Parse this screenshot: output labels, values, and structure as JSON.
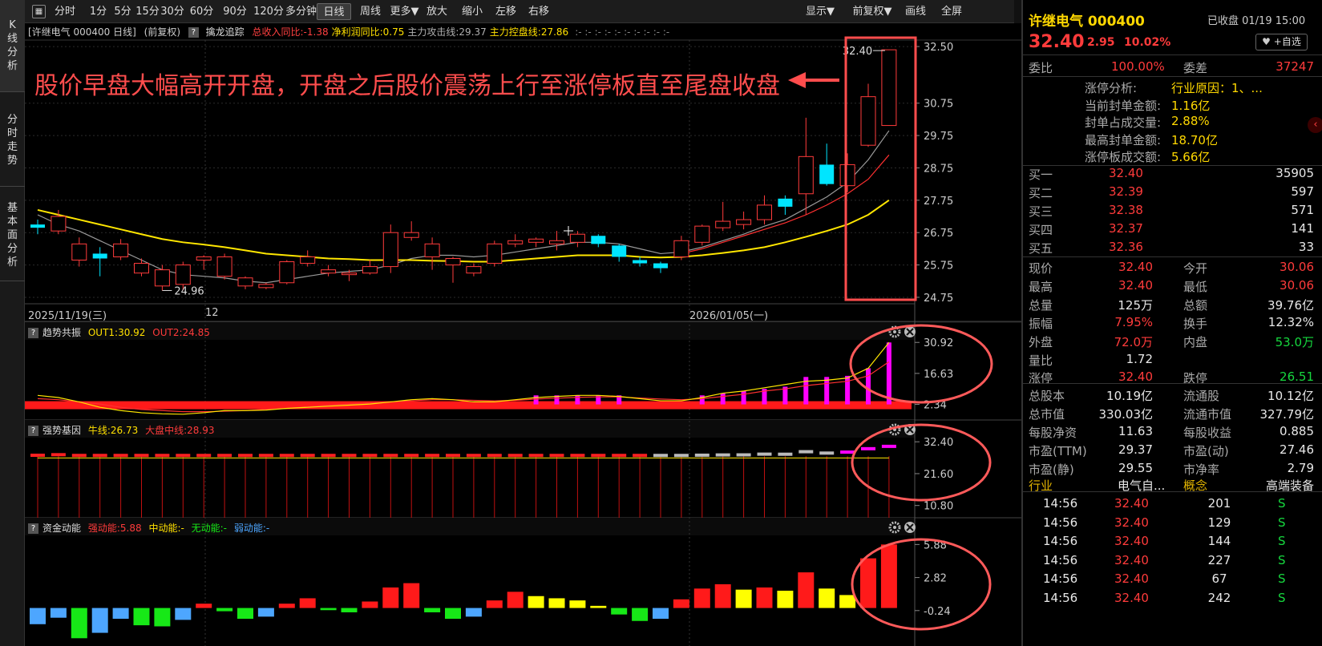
{
  "left_tabs": [
    {
      "label": "K线分析",
      "active": true
    },
    {
      "label": "分时走势",
      "active": false
    },
    {
      "label": "基本面分析",
      "active": false
    }
  ],
  "toolbar": {
    "left": [
      "分时",
      "1分",
      "5分",
      "15分",
      "30分",
      "60分",
      "90分",
      "120分",
      "多分钟",
      "日线",
      "周线",
      "更多▼",
      "放大",
      "缩小",
      "左移",
      "右移"
    ],
    "active": "日线",
    "right": [
      "显示▼",
      "前复权▼",
      "画线",
      "全屏"
    ]
  },
  "chart_info": {
    "stock_label": "[许继电气 000400 日线]",
    "fq": "(前复权)",
    "indicator": "擒龙追踪",
    "items": [
      {
        "text": "总收入同比:-1.38",
        "color": "#ff4040"
      },
      {
        "text": "净利润同比:0.75",
        "color": "#ffe000"
      },
      {
        "text": "主力攻击线:29.37",
        "color": "#b0b0b0"
      },
      {
        "text": "主力控盘线:27.86",
        "color": "#ffe000"
      }
    ]
  },
  "annotation": "股价早盘大幅高开开盘，开盘之后股价震荡上行至涨停板直至尾盘收盘",
  "dates": [
    "2025/11/19(三)",
    "12",
    "2026/01/05(一)"
  ],
  "chart_data": {
    "type": "candlestick",
    "y_ticks": [
      32.5,
      30.75,
      29.75,
      28.75,
      27.75,
      26.75,
      25.75,
      24.75
    ],
    "ylim": [
      24.6,
      32.7
    ],
    "candles": [
      {
        "o": 27.0,
        "c": 26.9,
        "h": 27.15,
        "l": 26.7
      },
      {
        "o": 26.8,
        "c": 27.25,
        "h": 27.45,
        "l": 26.7
      },
      {
        "o": 25.9,
        "c": 26.4,
        "h": 26.6,
        "l": 25.7
      },
      {
        "o": 26.1,
        "c": 25.95,
        "h": 26.3,
        "l": 25.4
      },
      {
        "o": 26.0,
        "c": 26.4,
        "h": 26.55,
        "l": 25.9
      },
      {
        "o": 25.5,
        "c": 25.8,
        "h": 25.95,
        "l": 25.4
      },
      {
        "o": 25.1,
        "c": 25.6,
        "h": 25.75,
        "l": 24.96
      },
      {
        "o": 25.15,
        "c": 25.75,
        "h": 25.85,
        "l": 24.96
      },
      {
        "o": 25.9,
        "c": 26.0,
        "h": 26.05,
        "l": 25.6
      },
      {
        "o": 25.4,
        "c": 26.0,
        "h": 26.1,
        "l": 25.3
      },
      {
        "o": 25.1,
        "c": 25.35,
        "h": 25.4,
        "l": 25.0
      },
      {
        "o": 25.05,
        "c": 25.15,
        "h": 25.2,
        "l": 25.0
      },
      {
        "o": 25.2,
        "c": 25.85,
        "h": 25.9,
        "l": 25.15
      },
      {
        "o": 25.8,
        "c": 26.0,
        "h": 26.2,
        "l": 25.7
      },
      {
        "o": 25.5,
        "c": 25.6,
        "h": 25.75,
        "l": 25.4
      },
      {
        "o": 25.45,
        "c": 25.5,
        "h": 25.6,
        "l": 25.25
      },
      {
        "o": 25.5,
        "c": 25.7,
        "h": 25.9,
        "l": 25.45
      },
      {
        "o": 25.7,
        "c": 26.75,
        "h": 27.0,
        "l": 25.5
      },
      {
        "o": 26.6,
        "c": 26.75,
        "h": 27.1,
        "l": 26.5
      },
      {
        "o": 26.0,
        "c": 26.4,
        "h": 26.6,
        "l": 25.6
      },
      {
        "o": 25.75,
        "c": 25.95,
        "h": 26.0,
        "l": 25.2
      },
      {
        "o": 25.5,
        "c": 25.7,
        "h": 25.8,
        "l": 25.4
      },
      {
        "o": 25.8,
        "c": 26.4,
        "h": 26.5,
        "l": 25.7
      },
      {
        "o": 26.4,
        "c": 26.5,
        "h": 26.7,
        "l": 26.3
      },
      {
        "o": 26.45,
        "c": 26.55,
        "h": 26.6,
        "l": 26.3
      },
      {
        "o": 26.4,
        "c": 26.5,
        "h": 26.8,
        "l": 26.2
      },
      {
        "o": 26.45,
        "c": 26.7,
        "h": 26.8,
        "l": 26.3
      },
      {
        "o": 26.65,
        "c": 26.4,
        "h": 26.7,
        "l": 26.3
      },
      {
        "o": 26.35,
        "c": 26.0,
        "h": 26.4,
        "l": 25.85
      },
      {
        "o": 25.9,
        "c": 25.8,
        "h": 26.0,
        "l": 25.7
      },
      {
        "o": 25.8,
        "c": 25.65,
        "h": 25.85,
        "l": 25.5
      },
      {
        "o": 26.0,
        "c": 26.5,
        "h": 26.65,
        "l": 25.9
      },
      {
        "o": 26.45,
        "c": 26.95,
        "h": 27.0,
        "l": 26.35
      },
      {
        "o": 26.9,
        "c": 27.1,
        "h": 27.7,
        "l": 26.8
      },
      {
        "o": 27.0,
        "c": 27.15,
        "h": 27.4,
        "l": 26.85
      },
      {
        "o": 27.15,
        "c": 27.6,
        "h": 27.9,
        "l": 27.0
      },
      {
        "o": 27.8,
        "c": 27.55,
        "h": 27.9,
        "l": 27.3
      },
      {
        "o": 27.95,
        "c": 29.1,
        "h": 30.3,
        "l": 27.3
      },
      {
        "o": 28.85,
        "c": 28.25,
        "h": 29.5,
        "l": 28.2
      },
      {
        "o": 28.2,
        "c": 28.85,
        "h": 29.2,
        "l": 28.0
      },
      {
        "o": 29.45,
        "c": 30.95,
        "h": 31.35,
        "l": 29.4
      },
      {
        "o": 30.06,
        "c": 32.4,
        "h": 32.4,
        "l": 30.06
      }
    ],
    "ma_yellow": [
      27.45,
      27.3,
      27.15,
      27.0,
      26.85,
      26.7,
      26.55,
      26.45,
      26.38,
      26.3,
      26.2,
      26.1,
      26.05,
      26.0,
      25.95,
      25.93,
      25.9,
      25.9,
      25.9,
      25.88,
      25.87,
      25.85,
      25.85,
      25.9,
      25.95,
      26.0,
      26.05,
      26.05,
      26.05,
      26.0,
      25.98,
      26.0,
      26.05,
      26.12,
      26.2,
      26.3,
      26.45,
      26.62,
      26.8,
      27.0,
      27.3,
      27.75
    ],
    "ma_red": [
      null,
      null,
      null,
      null,
      null,
      null,
      null,
      null,
      null,
      null,
      null,
      null,
      null,
      null,
      null,
      null,
      null,
      null,
      null,
      null,
      null,
      null,
      null,
      null,
      null,
      null,
      null,
      null,
      null,
      null,
      null,
      26.1,
      26.25,
      26.45,
      26.65,
      26.85,
      27.05,
      27.3,
      27.6,
      27.95,
      28.4,
      29.15
    ],
    "ma_grey": [
      27.3,
      27.0,
      26.8,
      26.5,
      26.2,
      25.9,
      25.6,
      25.45,
      25.4,
      25.35,
      25.25,
      25.2,
      25.3,
      25.4,
      25.5,
      25.55,
      25.6,
      25.75,
      25.95,
      26.05,
      26.05,
      26.0,
      26.05,
      26.15,
      26.25,
      26.35,
      26.45,
      26.45,
      26.4,
      26.25,
      26.1,
      26.15,
      26.3,
      26.5,
      26.7,
      26.95,
      27.15,
      27.5,
      27.85,
      28.3,
      29.0,
      29.9
    ],
    "low_label": "24.96",
    "high_label": "32.40"
  },
  "sub1": {
    "name": "趋势共振",
    "out1": "OUT1:30.92",
    "out2": "OUT2:24.85",
    "ticks": [
      "30.92",
      "16.63",
      "2.34"
    ],
    "ylim": [
      -3,
      31
    ],
    "line1": [
      6.5,
      5.5,
      3.5,
      1.0,
      -0.5,
      -1.5,
      -2.0,
      -2.2,
      -1.5,
      -0.5,
      -0.5,
      -0.3,
      0.5,
      1.0,
      1.5,
      2.0,
      2.5,
      3.5,
      4.5,
      5.0,
      4.5,
      3.5,
      3.5,
      4.5,
      5.5,
      6.0,
      6.5,
      6.5,
      6.0,
      5.0,
      4.0,
      4.0,
      5.5,
      7.5,
      8.5,
      10.0,
      11.5,
      13.0,
      13.5,
      14.5,
      19.0,
      30.9
    ],
    "line2": [
      5.0,
      4.5,
      3.5,
      2.5,
      1.0,
      0.0,
      -0.5,
      -1.0,
      -1.0,
      -0.8,
      -0.5,
      0.0,
      0.5,
      1.2,
      2.0,
      2.5,
      3.0,
      3.5,
      4.0,
      4.5,
      4.5,
      4.2,
      4.0,
      4.2,
      4.8,
      5.2,
      5.6,
      5.8,
      5.8,
      5.3,
      4.8,
      4.5,
      5.0,
      6.0,
      7.0,
      8.5,
      9.5,
      11.0,
      12.0,
      13.0,
      15.5,
      22.0
    ],
    "bars": [
      0,
      0,
      0,
      0,
      0,
      0,
      0,
      0,
      0,
      0,
      0,
      0,
      0,
      0,
      0,
      0,
      0,
      0,
      0,
      0,
      0,
      0,
      0,
      0,
      6.5,
      6.5,
      6.5,
      6.5,
      6.5,
      0,
      0,
      0,
      6.5,
      7.5,
      8.5,
      9.5,
      10.5,
      15.0,
      15.0,
      15.5,
      19.0,
      30.9
    ]
  },
  "sub2": {
    "name": "强势基因",
    "bull": "牛线:26.73",
    "mid": "大盘中线:28.93",
    "ticks": [
      "32.40",
      "21.60",
      "10.80"
    ],
    "ylim": [
      8,
      33
    ]
  },
  "sub3": {
    "name": "资金动能",
    "strong": "强动能:5.88",
    "medium": "中动能:-",
    "none": "无动能:-",
    "weak": "弱动能:-",
    "ticks": [
      "5.88",
      "2.82",
      "-0.24"
    ],
    "ylim": [
      -3,
      6.5
    ],
    "bars": [
      {
        "v": -1.5,
        "c": "#4da6ff"
      },
      {
        "v": -0.9,
        "c": "#4da6ff"
      },
      {
        "v": -2.8,
        "c": "#17e817"
      },
      {
        "v": -2.3,
        "c": "#4da6ff"
      },
      {
        "v": -1.0,
        "c": "#4da6ff"
      },
      {
        "v": -1.6,
        "c": "#17e817"
      },
      {
        "v": -1.7,
        "c": "#17e817"
      },
      {
        "v": -1.1,
        "c": "#4da6ff"
      },
      {
        "v": 0.4,
        "c": "#ff1a1a"
      },
      {
        "v": -0.3,
        "c": "#17e817"
      },
      {
        "v": -1.0,
        "c": "#17e817"
      },
      {
        "v": -0.8,
        "c": "#4da6ff"
      },
      {
        "v": 0.4,
        "c": "#ff1a1a"
      },
      {
        "v": 0.9,
        "c": "#ff1a1a"
      },
      {
        "v": -0.2,
        "c": "#17e817"
      },
      {
        "v": -0.4,
        "c": "#17e817"
      },
      {
        "v": 0.6,
        "c": "#ff1a1a"
      },
      {
        "v": 1.9,
        "c": "#ff1a1a"
      },
      {
        "v": 2.3,
        "c": "#ff1a1a"
      },
      {
        "v": -0.4,
        "c": "#17e817"
      },
      {
        "v": -1.0,
        "c": "#17e817"
      },
      {
        "v": -0.8,
        "c": "#4da6ff"
      },
      {
        "v": 0.7,
        "c": "#ff1a1a"
      },
      {
        "v": 1.5,
        "c": "#ff1a1a"
      },
      {
        "v": 1.1,
        "c": "#ffff00"
      },
      {
        "v": 0.9,
        "c": "#ffff00"
      },
      {
        "v": 0.7,
        "c": "#ffff00"
      },
      {
        "v": 0.2,
        "c": "#ffff00"
      },
      {
        "v": -0.6,
        "c": "#17e817"
      },
      {
        "v": -1.2,
        "c": "#17e817"
      },
      {
        "v": -1.0,
        "c": "#4da6ff"
      },
      {
        "v": 0.8,
        "c": "#ff1a1a"
      },
      {
        "v": 1.8,
        "c": "#ff1a1a"
      },
      {
        "v": 2.2,
        "c": "#ff1a1a"
      },
      {
        "v": 1.7,
        "c": "#ffff00"
      },
      {
        "v": 1.9,
        "c": "#ff1a1a"
      },
      {
        "v": 1.6,
        "c": "#ffff00"
      },
      {
        "v": 3.3,
        "c": "#ff1a1a"
      },
      {
        "v": 1.8,
        "c": "#ffff00"
      },
      {
        "v": 1.2,
        "c": "#ffff00"
      },
      {
        "v": 4.6,
        "c": "#ff1a1a"
      },
      {
        "v": 5.88,
        "c": "#ff1a1a"
      }
    ]
  },
  "panel": {
    "name": "许继电气 000400",
    "status": "已收盘 01/19 15:00",
    "price": "32.40",
    "change": "2.95",
    "pct": "10.02%",
    "add_label": "+自选",
    "weibi_label": "委比",
    "weibi": "100.00%",
    "weicha_label": "委差",
    "weicha": "37247",
    "zt_analysis": [
      {
        "k": "涨停分析:",
        "v": "行业原因：1、..."
      },
      {
        "k": "当前封单金额:",
        "v": "1.16亿"
      },
      {
        "k": "封单占成交量:",
        "v": "2.88%"
      },
      {
        "k": "最高封单金额:",
        "v": "18.70亿"
      },
      {
        "k": "涨停板成交额:",
        "v": "5.66亿"
      }
    ],
    "bids": [
      {
        "k": "买一",
        "p": "32.40",
        "v": "35905"
      },
      {
        "k": "买二",
        "p": "32.39",
        "v": "597"
      },
      {
        "k": "买三",
        "p": "32.38",
        "v": "571"
      },
      {
        "k": "买四",
        "p": "32.37",
        "v": "141"
      },
      {
        "k": "买五",
        "p": "32.36",
        "v": "33"
      }
    ],
    "quote": [
      {
        "k1": "现价",
        "v1": "32.40",
        "c1": "red",
        "k2": "今开",
        "v2": "30.06",
        "c2": "red"
      },
      {
        "k1": "最高",
        "v1": "32.40",
        "c1": "red",
        "k2": "最低",
        "v2": "30.06",
        "c2": "red"
      },
      {
        "k1": "总量",
        "v1": "125万",
        "c1": "white",
        "k2": "总额",
        "v2": "39.76亿",
        "c2": "white"
      },
      {
        "k1": "振幅",
        "v1": "7.95%",
        "c1": "red",
        "k2": "换手",
        "v2": "12.32%",
        "c2": "white"
      },
      {
        "k1": "外盘",
        "v1": "72.0万",
        "c1": "red",
        "k2": "内盘",
        "v2": "53.0万",
        "c2": "green"
      },
      {
        "k1": "量比",
        "v1": "1.72",
        "c1": "white",
        "k2": "",
        "v2": "",
        "c2": "white"
      }
    ],
    "limit": {
      "up_label": "涨停",
      "up": "32.40",
      "down_label": "跌停",
      "down": "26.51"
    },
    "fund": [
      {
        "k1": "总股本",
        "v1": "10.19亿",
        "k2": "流通股",
        "v2": "10.12亿"
      },
      {
        "k1": "总市值",
        "v1": "330.03亿",
        "k2": "流通市值",
        "v2": "327.79亿"
      },
      {
        "k1": "每股净资",
        "v1": "11.63",
        "k2": "每股收益",
        "v2": "0.885"
      },
      {
        "k1": "市盈(TTM)",
        "v1": "29.37",
        "k2": "市盈(动)",
        "v2": "27.46"
      },
      {
        "k1": "市盈(静)",
        "v1": "29.55",
        "k2": "市净率",
        "v2": "2.79"
      }
    ],
    "industry": {
      "k1": "行业",
      "v1": "电气自...",
      "k2": "概念",
      "v2": "高端装备"
    },
    "trades": [
      {
        "t": "14:56",
        "p": "32.40",
        "v": "201",
        "s": "S"
      },
      {
        "t": "14:56",
        "p": "32.40",
        "v": "129",
        "s": "S"
      },
      {
        "t": "14:56",
        "p": "32.40",
        "v": "144",
        "s": "S"
      },
      {
        "t": "14:56",
        "p": "32.40",
        "v": "227",
        "s": "S"
      },
      {
        "t": "14:56",
        "p": "32.40",
        "v": "67",
        "s": "S"
      },
      {
        "t": "14:56",
        "p": "32.40",
        "v": "242",
        "s": "S"
      }
    ]
  }
}
